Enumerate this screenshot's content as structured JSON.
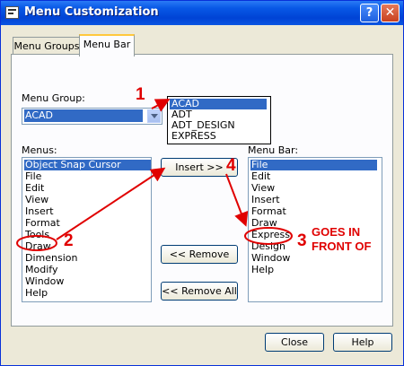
{
  "window": {
    "title": "Menu Customization",
    "help_label": "?",
    "close_label": "✕"
  },
  "tabs": [
    {
      "label": "Menu Groups"
    },
    {
      "label": "Menu Bar"
    }
  ],
  "menu_group": {
    "label": "Menu Group:",
    "selected": "ACAD",
    "options": [
      "ACAD",
      "ADT",
      "ADT_DESIGN",
      "EXPRESS"
    ]
  },
  "menus": {
    "label": "Menus:",
    "items": [
      "Object Snap Cursor Menu",
      "File",
      "Edit",
      "View",
      "Insert",
      "Format",
      "Tools",
      "Draw",
      "Dimension",
      "Modify",
      "Window",
      "Help"
    ]
  },
  "menu_bar": {
    "label": "Menu Bar:",
    "items": [
      "File",
      "Edit",
      "View",
      "Insert",
      "Format",
      "Draw",
      "Express",
      "Design",
      "Window",
      "Help"
    ]
  },
  "buttons": {
    "insert": "Insert >>",
    "remove": "<< Remove",
    "remove_all": "<< Remove All",
    "close": "Close",
    "help": "Help"
  },
  "annotations": {
    "step1": "1",
    "step2": "2",
    "step3": "3",
    "step4": "4",
    "note_line1": "GOES IN",
    "note_line2": "FRONT OF"
  },
  "colors": {
    "annotation": "#e00000",
    "selection": "#316ac5"
  }
}
